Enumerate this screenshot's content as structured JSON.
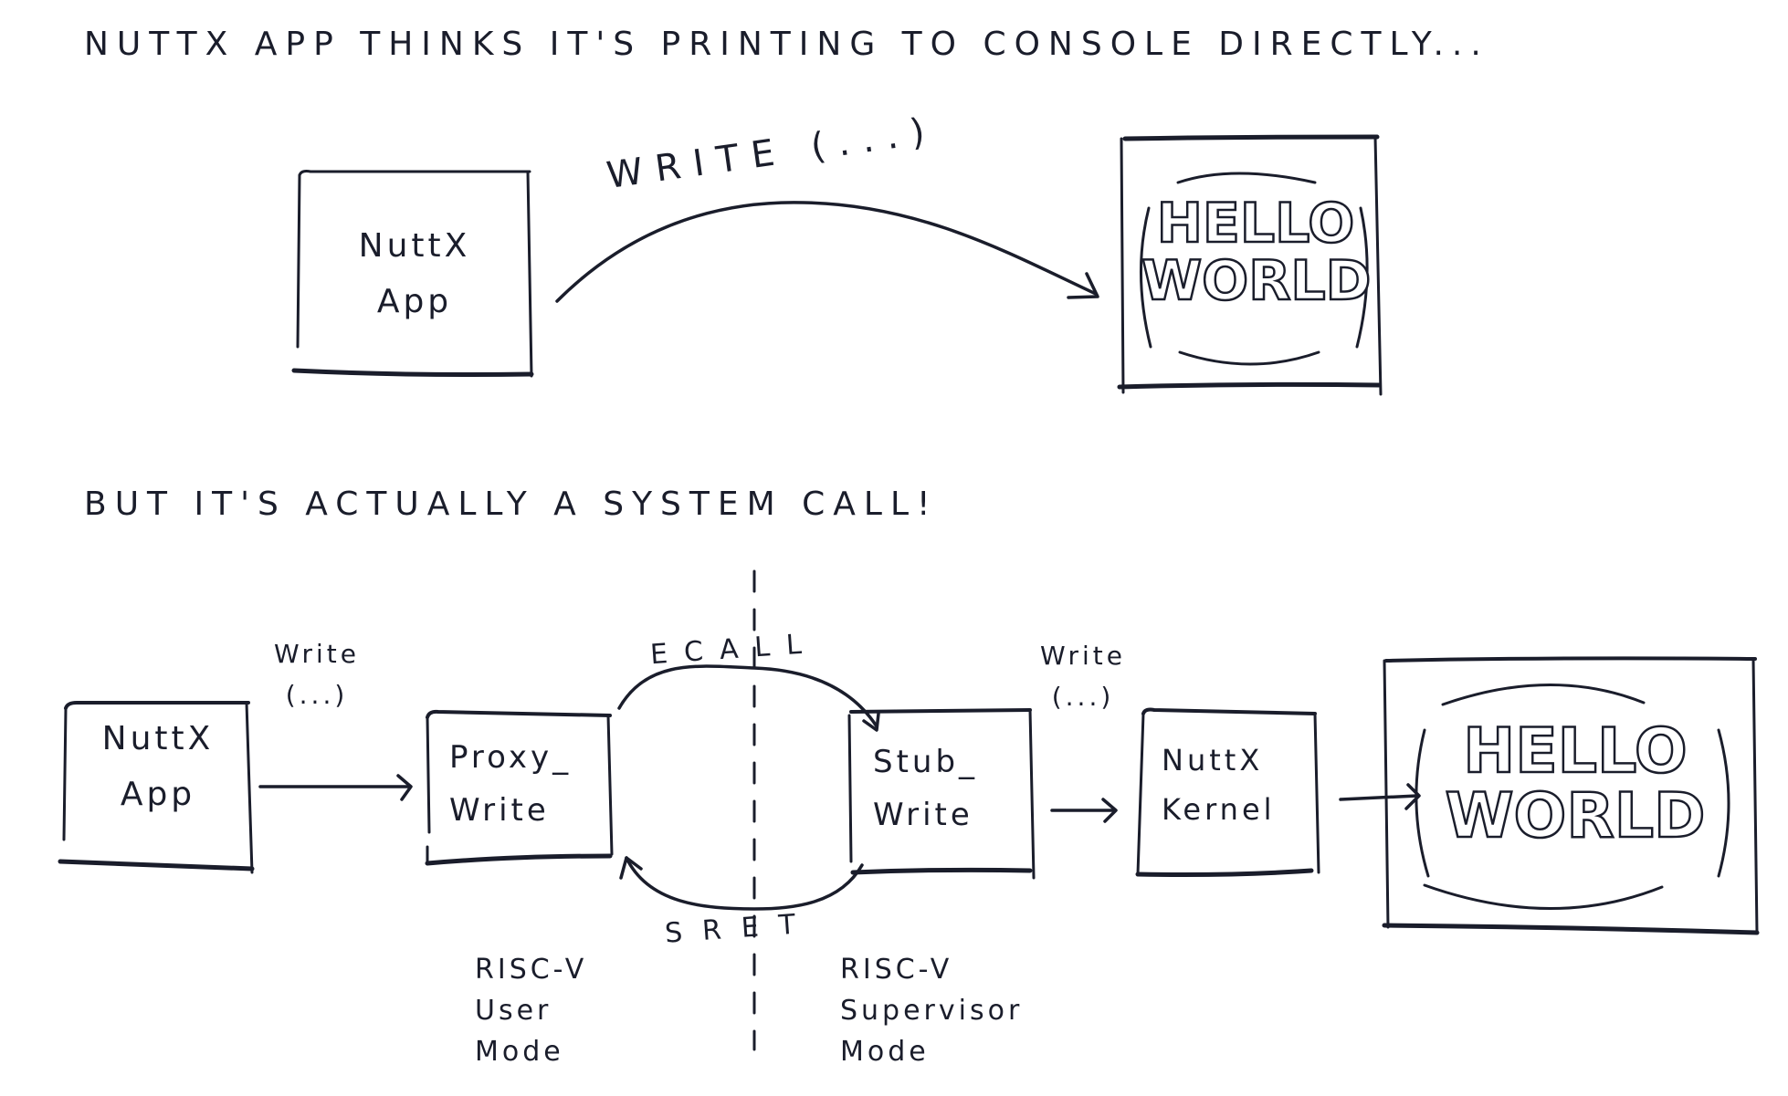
{
  "top_section": {
    "heading": "NuttX App thinks it's printing to console directly...",
    "app_box": {
      "line1": "NuttX",
      "line2": "App"
    },
    "arrow_label": "write (...)",
    "console": {
      "line1": "HELLO",
      "line2": "WORLD"
    }
  },
  "bottom_section": {
    "heading": "But it's actually a System Call!",
    "app_box": {
      "line1": "NuttX",
      "line2": "App"
    },
    "write_label_1": {
      "line1": "Write",
      "line2": "(...)"
    },
    "proxy_box": {
      "line1": "Proxy_",
      "line2": "Write"
    },
    "ecall_label": "ECALL",
    "sret_label": "SRET",
    "stub_box": {
      "line1": "Stub_",
      "line2": "Write"
    },
    "write_label_2": {
      "line1": "Write",
      "line2": "(...)"
    },
    "kernel_box": {
      "line1": "NuttX",
      "line2": "Kernel"
    },
    "console": {
      "line1": "HELLO",
      "line2": "WORLD"
    },
    "user_mode_label": {
      "line1": "RISC-V",
      "line2": "User",
      "line3": "Mode"
    },
    "supervisor_mode_label": {
      "line1": "RISC-V",
      "line2": "Supervisor",
      "line3": "Mode"
    }
  }
}
